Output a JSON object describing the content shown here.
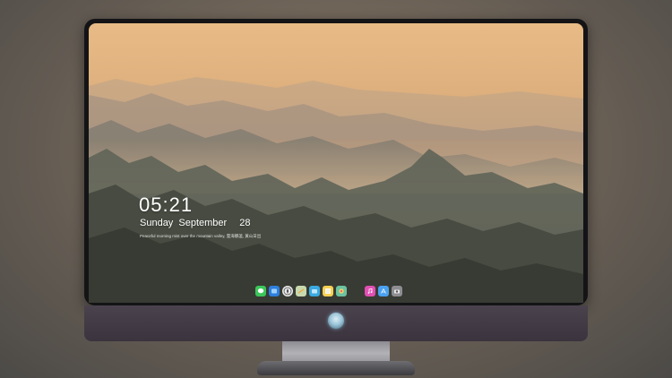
{
  "lockscreen": {
    "time": "05:21",
    "weekday": "Sunday",
    "month": "September",
    "day": "28",
    "caption": "Peaceful morning mist over the mountain valley, 雲海靜謐, 黃山日出"
  },
  "dock": {
    "apps": [
      {
        "name": "messages-icon",
        "color": "#3cc65a"
      },
      {
        "name": "finder-icon",
        "color": "#2e7fdc"
      },
      {
        "name": "safari-icon",
        "color": "#e8e8ea"
      },
      {
        "name": "maps-icon",
        "color": "#c8d9ae"
      },
      {
        "name": "files-icon",
        "color": "#3aa9e0"
      },
      {
        "name": "notes-icon",
        "color": "#f7d154"
      },
      {
        "name": "photos-icon",
        "color": "#6cc3a0"
      },
      {
        "name": "music-icon",
        "color": "#e24fb3"
      },
      {
        "name": "app-store-icon",
        "color": "#4aa1f0"
      },
      {
        "name": "camera-icon",
        "color": "#8e8e92"
      }
    ]
  },
  "colors": {
    "sky": "#e8bb86",
    "bezel": "#141416",
    "chin": "#4a424c",
    "stand": "#b2b2b6"
  }
}
